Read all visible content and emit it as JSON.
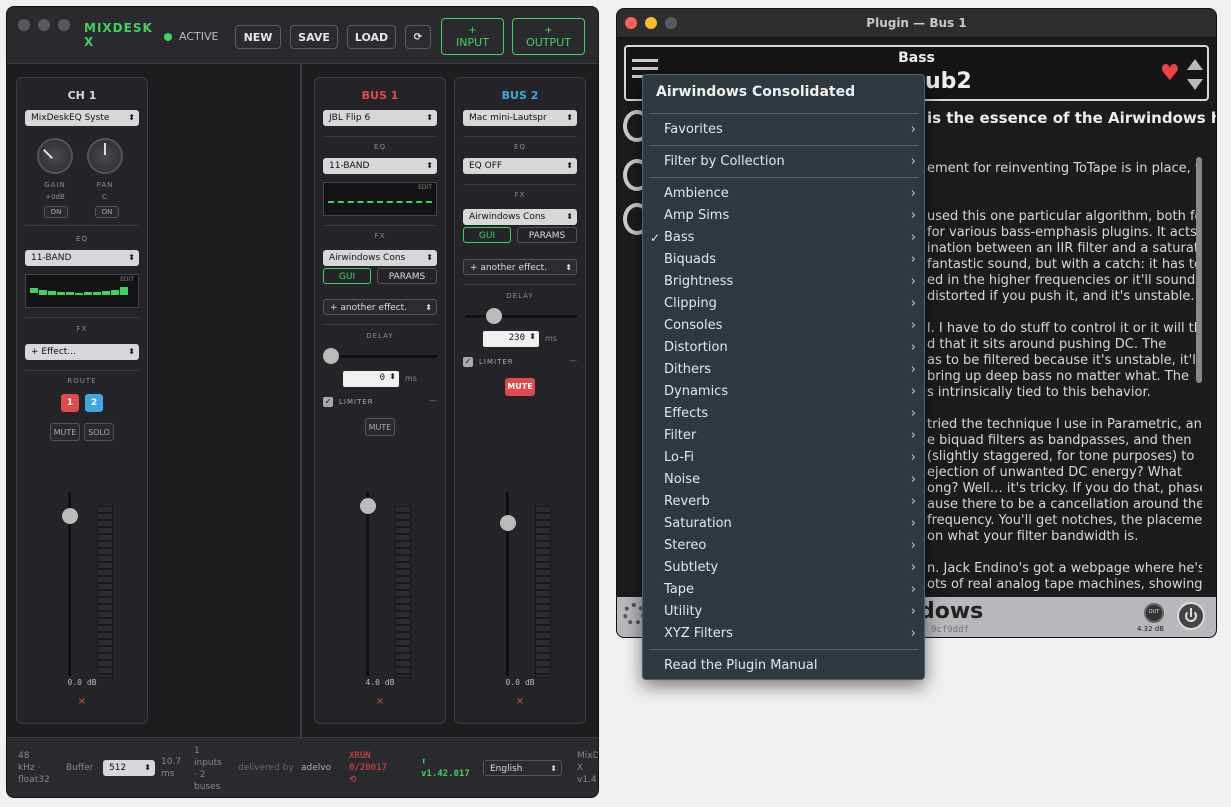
{
  "mixdesk": {
    "title": "MIXDESK X",
    "status": "ACTIVE",
    "buttons": {
      "new": "NEW",
      "save": "SAVE",
      "load": "LOAD",
      "refresh": "⟳",
      "input_plus": "+",
      "input": "INPUT",
      "output_plus": "+",
      "output": "OUTPUT"
    },
    "ch1": {
      "title": "CH 1",
      "device": "MixDeskEQ Syste",
      "gain_label": "GAIN",
      "gain_value": "+0dB",
      "gain_toggle": "ON",
      "pan_label": "PAN",
      "pan_value": "C",
      "pan_toggle": "ON",
      "eq_label": "EQ",
      "eq_select": "11-BAND",
      "eq_edit": "EDIT",
      "fx_label": "FX",
      "fx_select": "+ Effect...",
      "route_label": "ROUTE",
      "route_1": "1",
      "route_2": "2",
      "mute": "MUTE",
      "solo": "SOLO",
      "fader_value": "0.0 dB",
      "remove": "×"
    },
    "bus1": {
      "title": "BUS 1",
      "device": "JBL Flip 6",
      "eq_label": "EQ",
      "eq_select": "11-BAND",
      "eq_edit": "EDIT",
      "fx_label": "FX",
      "fx_select": "Airwindows Cons",
      "gui": "GUI",
      "params": "PARAMS",
      "another": "+ another effect.",
      "delay_label": "DELAY",
      "delay_value": "0",
      "delay_unit": "ms",
      "limiter": "LIMITER",
      "limiter_dash": "—",
      "mute": "MUTE",
      "fader_value": "4.0 dB",
      "remove": "×"
    },
    "bus2": {
      "title": "BUS 2",
      "device": "Mac mini-Lautspr",
      "eq_label": "EQ",
      "eq_select": "EQ OFF",
      "fx_label": "FX",
      "fx_select": "Airwindows Cons",
      "gui": "GUI",
      "params": "PARAMS",
      "another": "+ another effect.",
      "delay_label": "DELAY",
      "delay_value": "230",
      "delay_unit": "ms",
      "limiter": "LIMITER",
      "limiter_dash": "—",
      "mute": "MUTE",
      "fader_value": "0.0 dB",
      "remove": "×"
    },
    "footer": {
      "rate_1": "48",
      "rate_2": "kHz ·",
      "rate_3": "float32",
      "buffer_label": "Buffer",
      "buffer_value": "512",
      "latency_1": "10.7",
      "latency_2": "ms",
      "io_1": "1",
      "io_2": "inputs",
      "io_3": "· 2",
      "io_4": "buses",
      "delivered_by": "delivered by",
      "brand": "adelvo",
      "xrun_label": "XRUN",
      "xrun_value": "0/20017",
      "xrun_icon": "⟲",
      "update_icon": "⬆",
      "version": "v1.42.017",
      "language": "English",
      "app_1": "MixD",
      "app_2": "X",
      "app_3": "v1.4"
    }
  },
  "plugin": {
    "window_title": "Plugin — Bus 1",
    "category": "Bass",
    "name_fragment": "ub2",
    "heart": "♥",
    "headline_fragment": "is the essence of the Airwindows head",
    "paragraphs": [
      "ement for reinventing ToTape is in place, with",
      "used this one particular algorithm, both for",
      "for various bass-emphasis plugins. It acts",
      "ination between an IIR filter and a saturation.",
      "fantastic sound, but with a catch: it has to",
      "ed in the higher frequencies or it'll sound",
      "distorted if you push it, and it's unstable.",
      "l. I have to do stuff to control it or it will throw",
      "d that it sits around pushing DC. The",
      "as to be filtered because it's unstable, it'll",
      "bring up deep bass no matter what. The",
      "s intrinsically tied to this behavior.",
      "tried the technique I use in Parametric, and",
      "e biquad filters as bandpasses, and then",
      "(slightly staggered, for tone purposes) to",
      "ejection of unwanted DC energy? What",
      "ong? Well… it's tricky. If you do that, phase",
      "ause there to be a cancellation around the",
      "frequency. You'll get notches, the placement",
      "on what your filter bandwidth is.",
      "n. Jack Endino's got a webpage where he's",
      "ots of real analog tape machines, showing"
    ],
    "footer_brand": "dows",
    "footer_hash": "9cf9ddf",
    "out_label": "OUT",
    "out_value": "4.32 dB"
  },
  "menu": {
    "header": "Airwindows Consolidated",
    "top_items": [
      "Favorites",
      "Filter by Collection"
    ],
    "categories": [
      "Ambience",
      "Amp Sims",
      "Bass",
      "Biquads",
      "Brightness",
      "Clipping",
      "Consoles",
      "Distortion",
      "Dithers",
      "Dynamics",
      "Effects",
      "Filter",
      "Lo-Fi",
      "Noise",
      "Reverb",
      "Saturation",
      "Stereo",
      "Subtlety",
      "Tape",
      "Utility",
      "XYZ Filters"
    ],
    "checked": "Bass",
    "check_mark": "✓",
    "chevron": "›",
    "manual": "Read the Plugin Manual"
  },
  "colors": {
    "accent_green": "#3ed25f",
    "bus1_red": "#e04a4a",
    "bus2_blue": "#3fa7e0",
    "mute_red": "#e04a4a",
    "menu_bg": "#2f393f"
  }
}
